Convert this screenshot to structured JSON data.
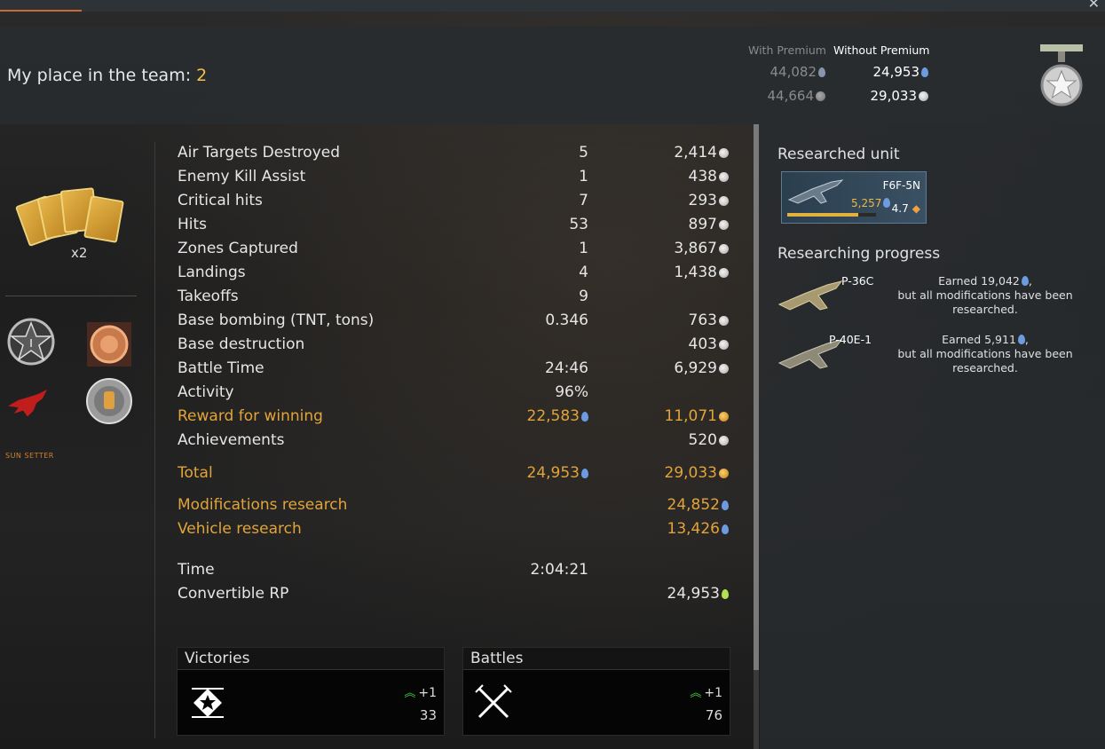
{
  "header": {
    "place_label": "My place in the team: ",
    "place_value": "2",
    "with_premium_label": "With Premium",
    "without_premium_label": "Without Premium",
    "with_premium_rp": "44,082",
    "with_premium_sl": "44,664",
    "without_premium_rp": "24,953",
    "without_premium_sl": "29,033"
  },
  "left": {
    "multiplier": "x2",
    "sunset_text": "SUN SETTER"
  },
  "stats": [
    {
      "label": "Air Targets Destroyed",
      "value": "5",
      "reward": "2,414",
      "reward_icon": "silver-lions-icon",
      "highlight": false
    },
    {
      "label": "Enemy Kill Assist",
      "value": "1",
      "reward": "438",
      "reward_icon": "silver-lions-icon",
      "highlight": false
    },
    {
      "label": "Critical hits",
      "value": "7",
      "reward": "293",
      "reward_icon": "silver-lions-icon",
      "highlight": false
    },
    {
      "label": "Hits",
      "value": "53",
      "reward": "897",
      "reward_icon": "silver-lions-icon",
      "highlight": false
    },
    {
      "label": "Zones Captured",
      "value": "1",
      "reward": "3,867",
      "reward_icon": "silver-lions-icon",
      "highlight": false
    },
    {
      "label": "Landings",
      "value": "4",
      "reward": "1,438",
      "reward_icon": "silver-lions-icon",
      "highlight": false
    },
    {
      "label": "Takeoffs",
      "value": "9",
      "reward": "",
      "reward_icon": "",
      "highlight": false
    },
    {
      "label": "Base bombing (TNT, tons)",
      "value": "0.346",
      "reward": "763",
      "reward_icon": "silver-lions-icon",
      "highlight": false
    },
    {
      "label": "Base destruction",
      "value": "",
      "reward": "403",
      "reward_icon": "silver-lions-icon",
      "highlight": false
    },
    {
      "label": "Battle Time",
      "value": "24:46",
      "reward": "6,929",
      "reward_icon": "silver-lions-icon",
      "highlight": false
    },
    {
      "label": "Activity",
      "value": "96%",
      "reward": "",
      "reward_icon": "",
      "highlight": false
    },
    {
      "label": "Reward for winning",
      "value": "22,583",
      "value_icon": "rp-icon",
      "reward": "11,071",
      "reward_icon": "silver-lions-icon",
      "highlight": true
    },
    {
      "label": "Achievements",
      "value": "",
      "reward": "520",
      "reward_icon": "silver-lions-icon",
      "highlight": false
    }
  ],
  "total": {
    "label": "Total",
    "rp": "24,953",
    "sl": "29,033"
  },
  "research": [
    {
      "label": "Modifications research",
      "value": "24,852"
    },
    {
      "label": "Vehicle research",
      "value": "13,426"
    }
  ],
  "time": {
    "label": "Time",
    "value": "2:04:21"
  },
  "convertible": {
    "label": "Convertible RP",
    "value": "24,953"
  },
  "victories": {
    "title": "Victories",
    "delta": "+1",
    "count": "33"
  },
  "battles": {
    "title": "Battles",
    "delta": "+1",
    "count": "76"
  },
  "right": {
    "researched_title": "Researched unit",
    "unit_name": "F6F-5N",
    "unit_rp": "5,257",
    "unit_br": "4.7",
    "unit_progress": 0.8,
    "progress_title": "Researching progress",
    "items": [
      {
        "name": "P-36C",
        "note_line1": "Earned 19,042",
        "note_line2": "but all modifications have been researched."
      },
      {
        "name": "P-40E-1",
        "note_line1": "Earned 5,911",
        "note_line2": "but all modifications have been researched."
      }
    ]
  },
  "colors": {
    "accent": "#e2a43a",
    "rp": "#6d9be0",
    "convertible": "#b3e050",
    "delta": "#46d14b"
  }
}
